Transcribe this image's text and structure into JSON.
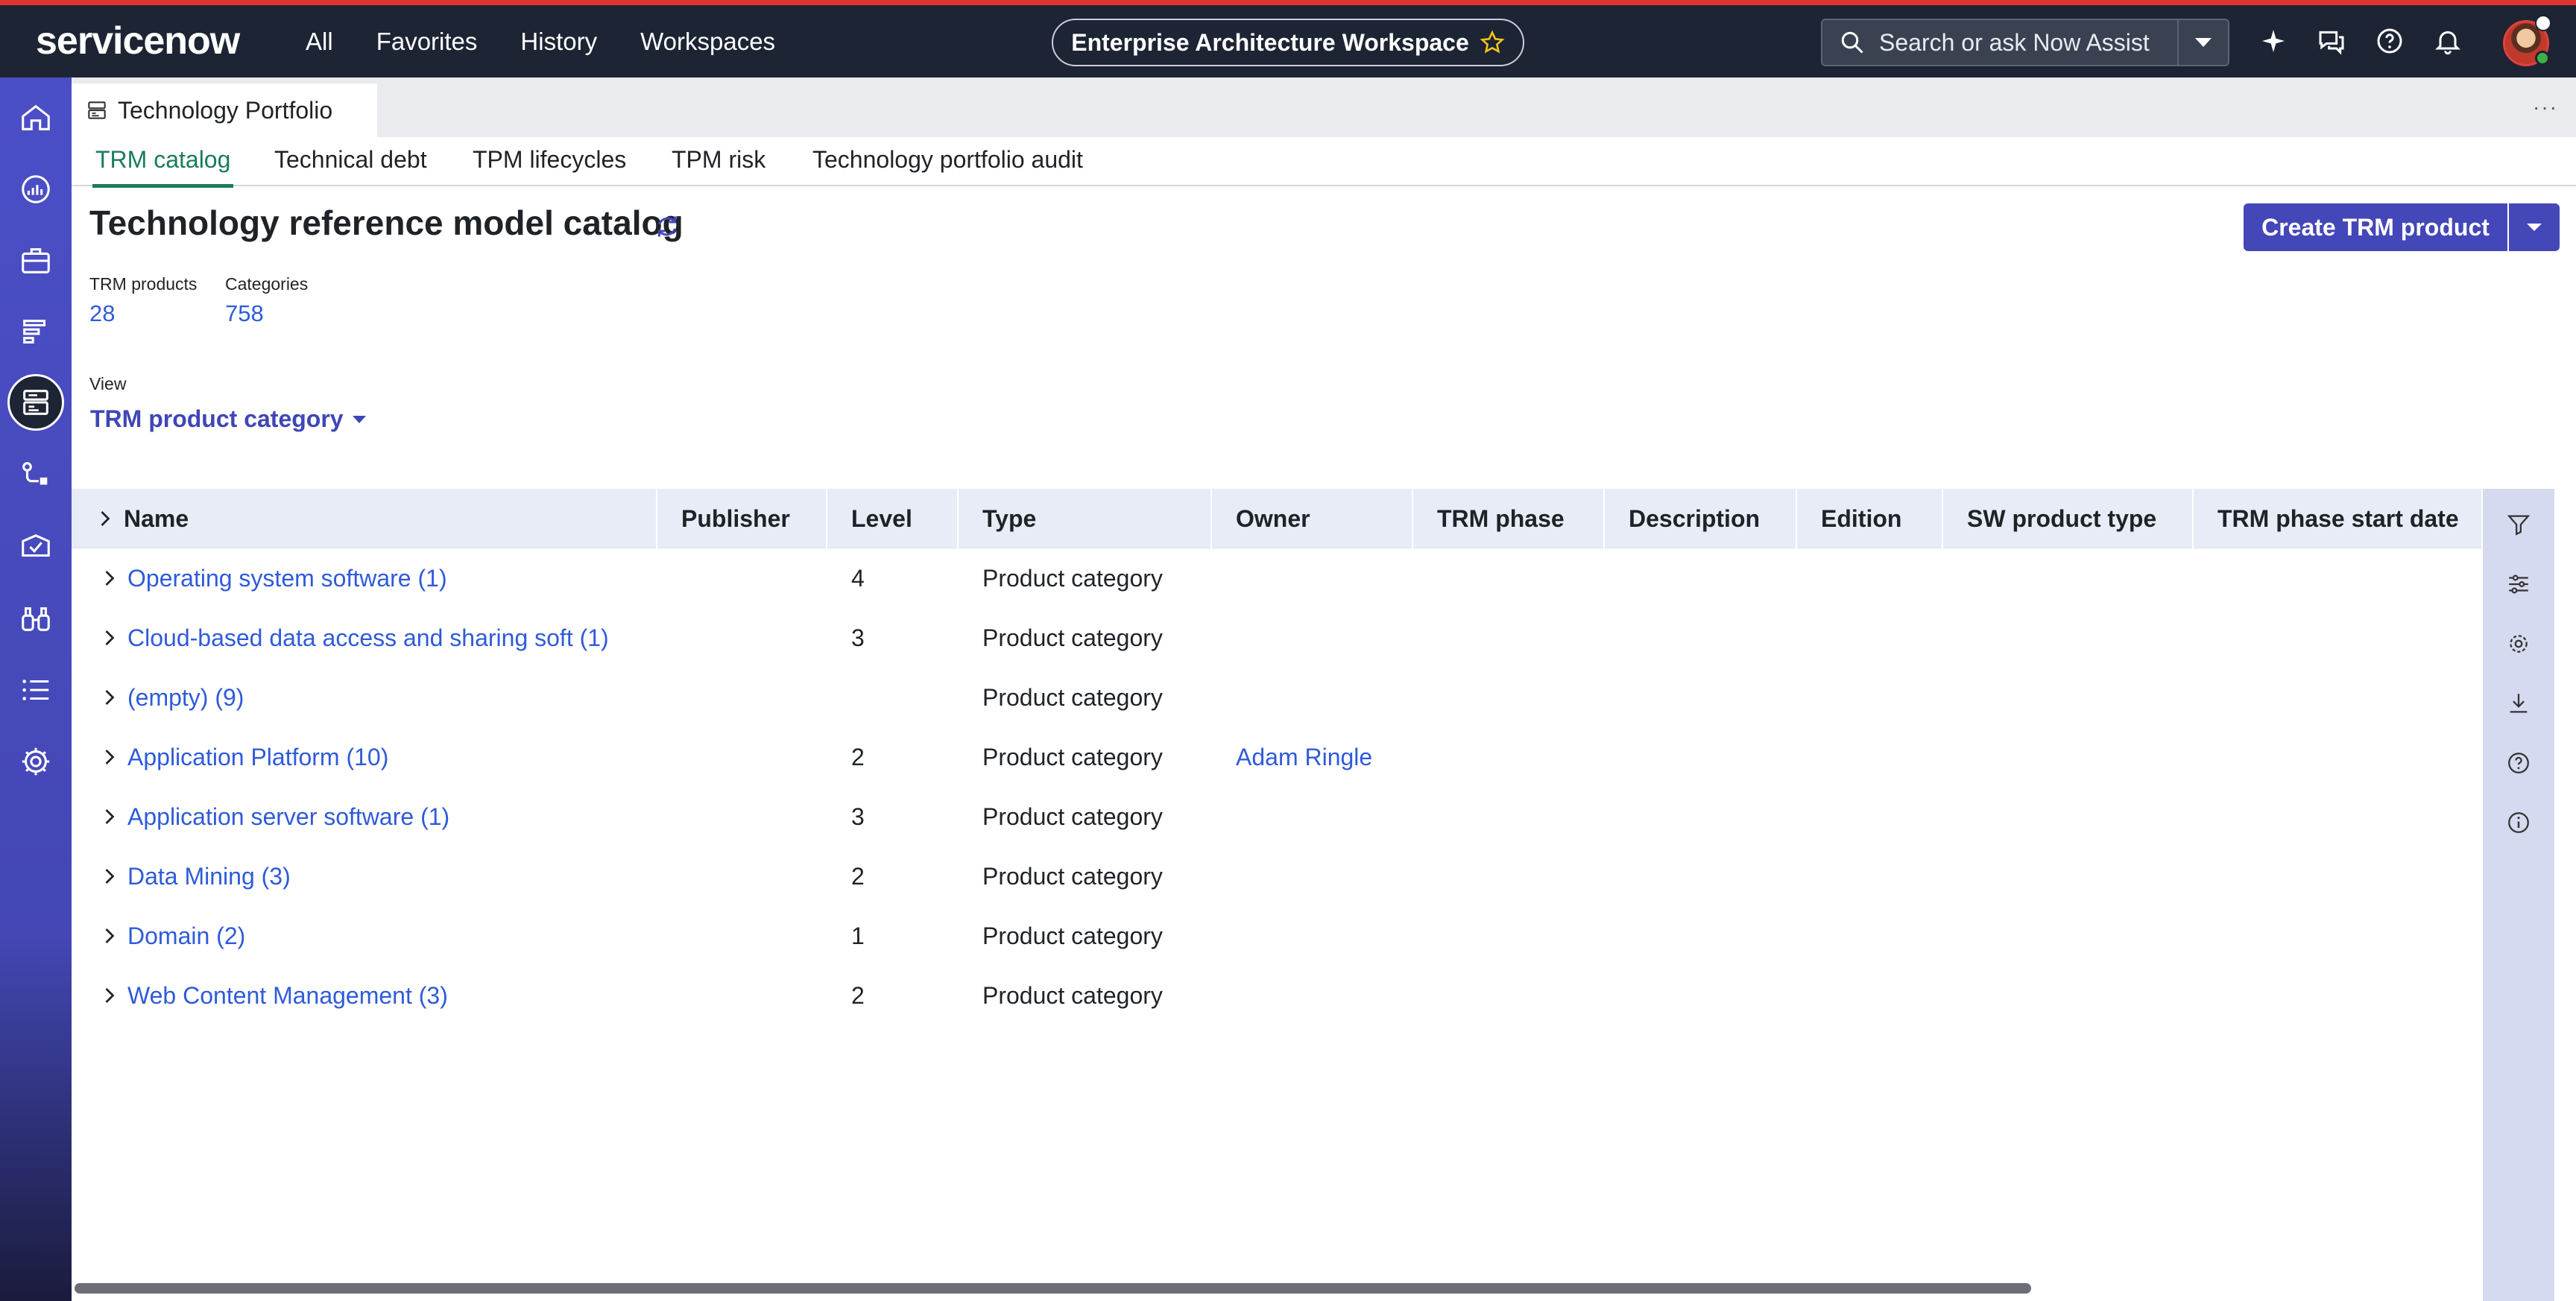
{
  "app": {
    "logo_text": "servicenow",
    "nav": [
      "All",
      "Favorites",
      "History",
      "Workspaces"
    ],
    "workspace_title": "Enterprise Architecture Workspace",
    "search_placeholder": "Search or ask Now Assist"
  },
  "sidebar": {
    "icons": [
      "home-icon",
      "dashboard-icon",
      "portfolio-icon",
      "reports-icon",
      "catalog-icon",
      "flow-icon",
      "approvals-icon",
      "binoculars-icon",
      "list-icon",
      "settings-icon"
    ],
    "active": "catalog-icon"
  },
  "tabstrip": {
    "tab_label": "Technology Portfolio",
    "more": "···"
  },
  "subtabs": [
    "TRM catalog",
    "Technical debt",
    "TPM lifecycles",
    "TPM risk",
    "Technology portfolio audit"
  ],
  "page": {
    "title": "Technology reference model catalog",
    "create_button": "Create TRM product",
    "stats": [
      {
        "label": "TRM products",
        "value": "28"
      },
      {
        "label": "Categories",
        "value": "758"
      }
    ],
    "view_label": "View",
    "view_value": "TRM product category"
  },
  "table": {
    "columns": [
      "Name",
      "Publisher",
      "Level",
      "Type",
      "Owner",
      "TRM phase",
      "Description",
      "Edition",
      "SW product type",
      "TRM phase start date"
    ],
    "rows": [
      {
        "name": "Operating system software (1)",
        "level": "4",
        "type": "Product category",
        "owner": ""
      },
      {
        "name": "Cloud-based data access and sharing soft (1)",
        "level": "3",
        "type": "Product category",
        "owner": ""
      },
      {
        "name": "(empty) (9)",
        "level": "",
        "type": "Product category",
        "owner": ""
      },
      {
        "name": "Application Platform (10)",
        "level": "2",
        "type": "Product category",
        "owner": "Adam Ringle"
      },
      {
        "name": "Application server software (1)",
        "level": "3",
        "type": "Product category",
        "owner": ""
      },
      {
        "name": "Data Mining (3)",
        "level": "2",
        "type": "Product category",
        "owner": ""
      },
      {
        "name": "Domain (2)",
        "level": "1",
        "type": "Product category",
        "owner": ""
      },
      {
        "name": "Web Content Management (3)",
        "level": "2",
        "type": "Product category",
        "owner": ""
      }
    ]
  },
  "right_rail": [
    "filter-icon",
    "adjust-icon",
    "gear-icon",
    "download-icon",
    "help-icon",
    "info-icon"
  ],
  "colors": {
    "header_bg": "#1d2433",
    "accent_red": "#e0352f",
    "sidebar_bg": "#4b4fc6",
    "primary_button": "#4447b8",
    "link": "#2f5bd9",
    "active_tab": "#1a7b5f"
  }
}
